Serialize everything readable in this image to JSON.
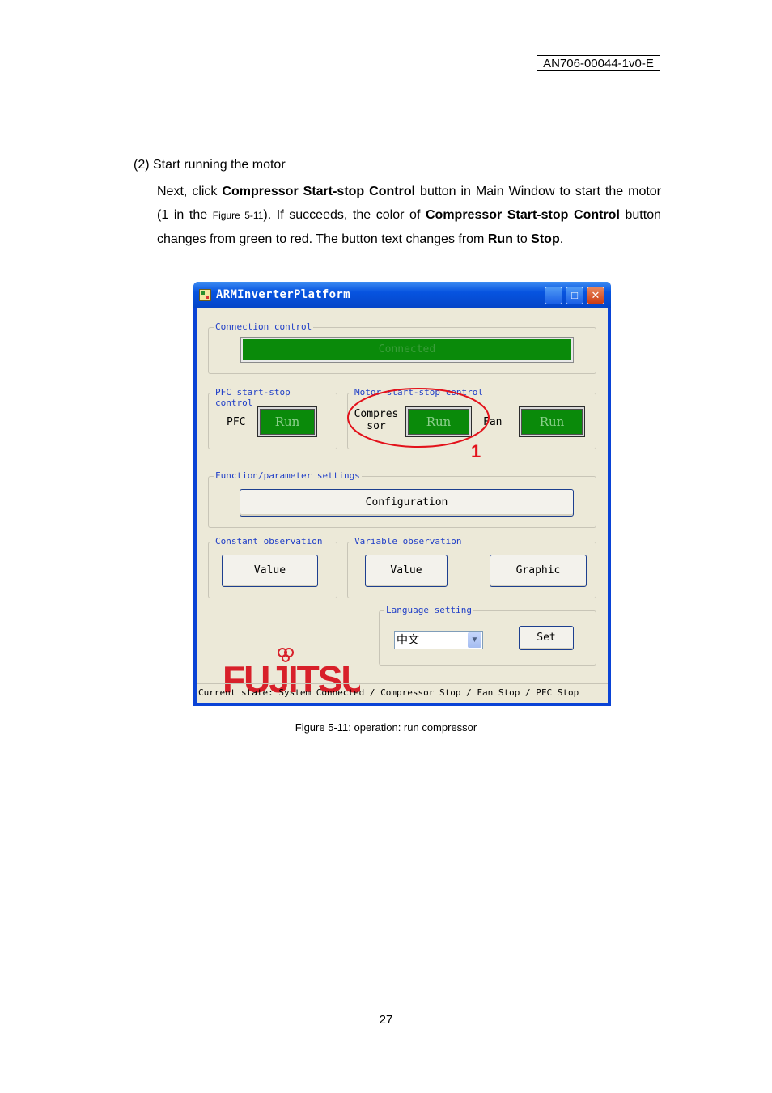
{
  "document": {
    "doc_id": "AN706-00044-1v0-E",
    "step_label": "(2)  Start running the motor",
    "para": {
      "p1": "Next, click ",
      "b1": "Compressor Start-stop Control",
      "p2": " button in Main Window to start the motor (1 in the ",
      "fig_ref": "Figure 5-11",
      "p3": "). If succeeds, the color of ",
      "b2": "Compressor Start-stop Control",
      "p4": " button changes from green to red. The button text changes from ",
      "b3": "Run",
      "p5": " to ",
      "b4": "Stop",
      "p6": "."
    },
    "caption": "Figure 5-11: operation: run compressor",
    "page_number": "27"
  },
  "window": {
    "title": "ARMInverterPlatform",
    "icons": [
      "app-icon",
      "minimize-icon",
      "maximize-icon",
      "close-icon"
    ],
    "connection": {
      "group": "Connection control",
      "status": "Connected"
    },
    "pfc": {
      "group": "PFC start-stop control",
      "label": "PFC",
      "button": "Run"
    },
    "motor": {
      "group": "Motor start-stop control",
      "compressor_label": "Compres sor",
      "compressor_button": "Run",
      "fan_label": "Fan",
      "fan_button": "Run"
    },
    "function": {
      "group": "Function/parameter settings",
      "button": "Configuration"
    },
    "constant": {
      "group": "Constant observation",
      "button": "Value"
    },
    "variable": {
      "group": "Variable observation",
      "value_button": "Value",
      "graphic_button": "Graphic"
    },
    "language": {
      "group": "Language setting",
      "selected": "中文",
      "set_button": "Set"
    },
    "logo": "FUJITSU",
    "status_bar": "Current state: System Connected / Compressor Stop / Fan Stop / PFC Stop",
    "colors": {
      "run_green": "#0a8a0a",
      "title_blue": "#0754e0",
      "logo_red": "#d8202a"
    }
  },
  "annotation": {
    "label": "1",
    "color": "#e3121b"
  }
}
